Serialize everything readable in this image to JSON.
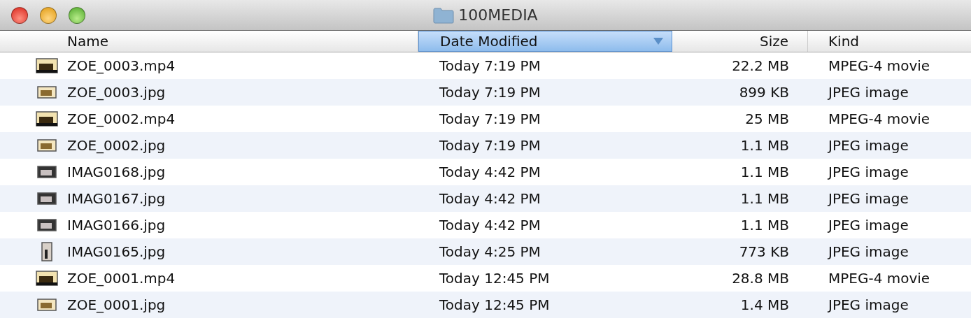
{
  "window": {
    "title": "100MEDIA"
  },
  "columns": [
    {
      "label": "Name",
      "selected": false
    },
    {
      "label": "Date Modified",
      "selected": true
    },
    {
      "label": "Size",
      "selected": false
    },
    {
      "label": "Kind",
      "selected": false
    }
  ],
  "rows": [
    {
      "kind": "video",
      "name": "ZOE_0003.mp4",
      "date": "Today 7:19 PM",
      "size": "22.2 MB",
      "file_kind": "MPEG-4 movie"
    },
    {
      "kind": "photo",
      "name": "ZOE_0003.jpg",
      "date": "Today 7:19 PM",
      "size": "899 KB",
      "file_kind": "JPEG image"
    },
    {
      "kind": "video",
      "name": "ZOE_0002.mp4",
      "date": "Today 7:19 PM",
      "size": "25 MB",
      "file_kind": "MPEG-4 movie"
    },
    {
      "kind": "photo",
      "name": "ZOE_0002.jpg",
      "date": "Today 7:19 PM",
      "size": "1.1 MB",
      "file_kind": "JPEG image"
    },
    {
      "kind": "dark",
      "name": "IMAG0168.jpg",
      "date": "Today 4:42 PM",
      "size": "1.1 MB",
      "file_kind": "JPEG image"
    },
    {
      "kind": "dark",
      "name": "IMAG0167.jpg",
      "date": "Today 4:42 PM",
      "size": "1.1 MB",
      "file_kind": "JPEG image"
    },
    {
      "kind": "dark",
      "name": "IMAG0166.jpg",
      "date": "Today 4:42 PM",
      "size": "1.1 MB",
      "file_kind": "JPEG image"
    },
    {
      "kind": "tall",
      "name": "IMAG0165.jpg",
      "date": "Today 4:25 PM",
      "size": "773 KB",
      "file_kind": "JPEG image"
    },
    {
      "kind": "video",
      "name": "ZOE_0001.mp4",
      "date": "Today 12:45 PM",
      "size": "28.8 MB",
      "file_kind": "MPEG-4 movie"
    },
    {
      "kind": "photo",
      "name": "ZOE_0001.jpg",
      "date": "Today 12:45 PM",
      "size": "1.4 MB",
      "file_kind": "JPEG image"
    }
  ]
}
